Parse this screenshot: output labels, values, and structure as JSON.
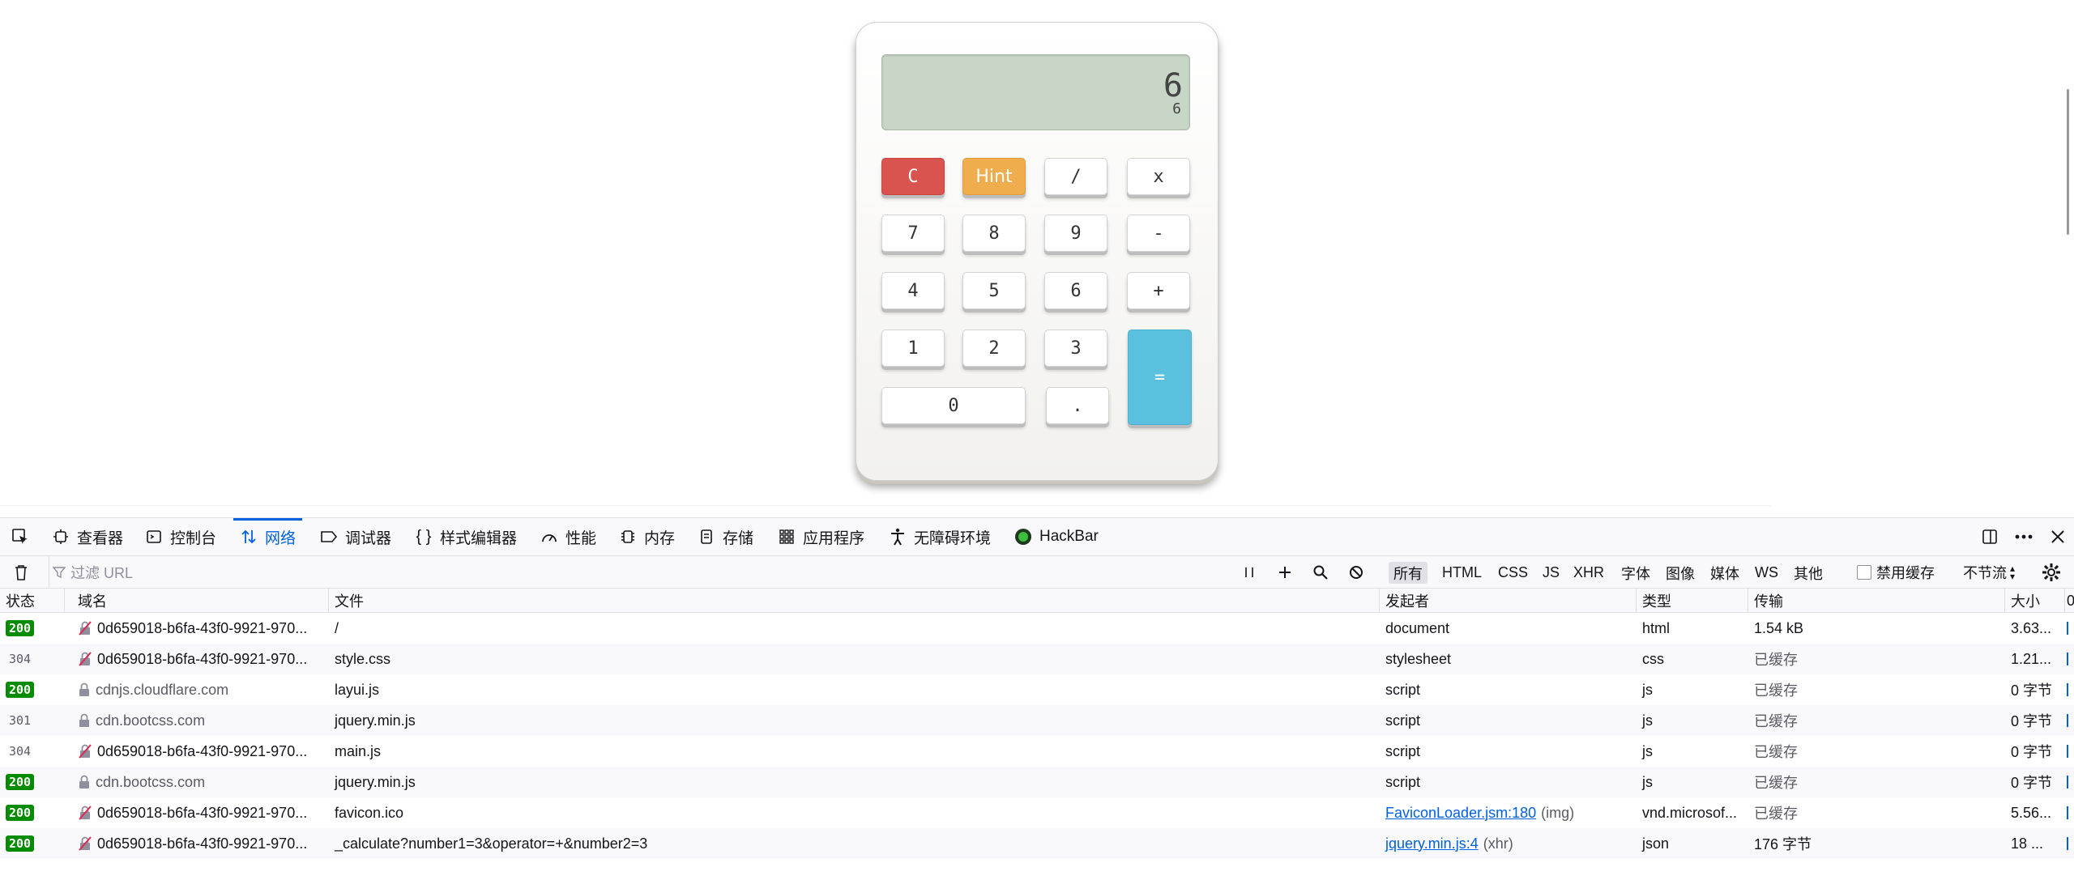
{
  "calculator": {
    "display_main": "6",
    "display_sub": "6",
    "keys": {
      "clear": "C",
      "hint": "Hint",
      "divide": "/",
      "multiply": "x",
      "seven": "7",
      "eight": "8",
      "nine": "9",
      "minus": "-",
      "four": "4",
      "five": "5",
      "six": "6",
      "plus": "+",
      "one": "1",
      "two": "2",
      "three": "3",
      "equals": "=",
      "zero": "0",
      "dot": "."
    },
    "colors": {
      "clear": "#d9534f",
      "hint": "#f0ad4e",
      "equals": "#5bc0de",
      "screen": "#c8d6c7"
    }
  },
  "devtools": {
    "tabs": {
      "inspector": "查看器",
      "console": "控制台",
      "network": "网络",
      "debugger": "调试器",
      "style_editor": "样式编辑器",
      "performance": "性能",
      "memory": "内存",
      "storage": "存储",
      "application": "应用程序",
      "accessibility": "无障碍环境",
      "hackbar": "HackBar"
    },
    "active_tab": "网络",
    "filter_placeholder": "过滤 URL",
    "type_filters": {
      "all": "所有",
      "html": "HTML",
      "css": "CSS",
      "js": "JS",
      "xhr": "XHR",
      "fonts": "字体",
      "images": "图像",
      "media": "媒体",
      "ws": "WS",
      "other": "其他"
    },
    "disable_cache": "禁用缓存",
    "throttle": "不节流",
    "columns": {
      "status": "状态",
      "domain": "域名",
      "file": "文件",
      "initiator": "发起者",
      "type": "类型",
      "transferred": "传输",
      "size": "大小",
      "extra": "0"
    },
    "rows": [
      {
        "status": "200",
        "domain": "0d659018-b6fa-43f0-9921-970...",
        "file": "/",
        "initiator": "document",
        "initiator_extra": "",
        "type": "html",
        "transferred": "1.54 kB",
        "size": "3.63..."
      },
      {
        "status": "304",
        "domain": "0d659018-b6fa-43f0-9921-970...",
        "file": "style.css",
        "initiator": "stylesheet",
        "initiator_extra": "",
        "type": "css",
        "transferred": "已缓存",
        "size": "1.21..."
      },
      {
        "status": "200",
        "domain": "cdnjs.cloudflare.com",
        "file": "layui.js",
        "initiator": "script",
        "initiator_extra": "",
        "type": "js",
        "transferred": "已缓存",
        "size": "0 字节"
      },
      {
        "status": "301",
        "domain": "cdn.bootcss.com",
        "file": "jquery.min.js",
        "initiator": "script",
        "initiator_extra": "",
        "type": "js",
        "transferred": "已缓存",
        "size": "0 字节"
      },
      {
        "status": "304",
        "domain": "0d659018-b6fa-43f0-9921-970...",
        "file": "main.js",
        "initiator": "script",
        "initiator_extra": "",
        "type": "js",
        "transferred": "已缓存",
        "size": "0 字节"
      },
      {
        "status": "200",
        "domain": "cdn.bootcss.com",
        "file": "jquery.min.js",
        "initiator": "script",
        "initiator_extra": "",
        "type": "js",
        "transferred": "已缓存",
        "size": "0 字节"
      },
      {
        "status": "200",
        "domain": "0d659018-b6fa-43f0-9921-970...",
        "file": "favicon.ico",
        "initiator": "FaviconLoader.jsm:180",
        "initiator_extra": "(img)",
        "type": "vnd.microsof...",
        "transferred": "已缓存",
        "size": "5.56..."
      },
      {
        "status": "200",
        "domain": "0d659018-b6fa-43f0-9921-970...",
        "file": "_calculate?number1=3&operator=+&number2=3",
        "initiator": "jquery.min.js:4",
        "initiator_extra": "(xhr)",
        "type": "json",
        "transferred": "176 字节",
        "size": "18 ..."
      }
    ]
  }
}
